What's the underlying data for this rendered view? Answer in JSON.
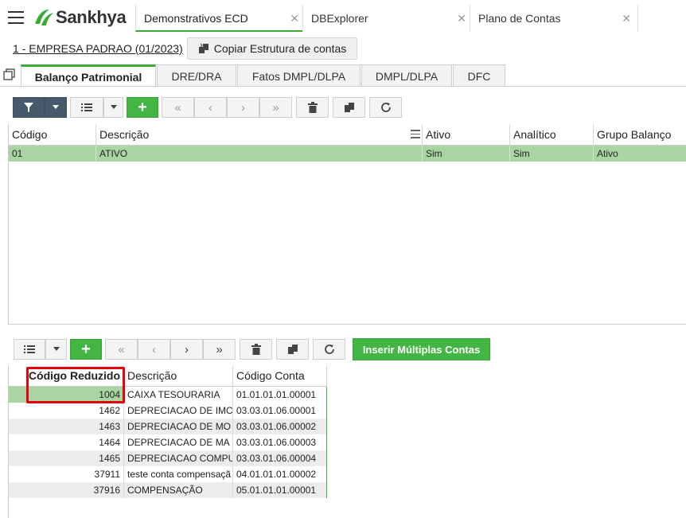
{
  "app": {
    "brand": "Sankhya"
  },
  "top_tabs": [
    {
      "label": "Demonstrativos ECD",
      "active": true
    },
    {
      "label": "DBExplorer",
      "active": false
    },
    {
      "label": "Plano de Contas",
      "active": false
    }
  ],
  "company": {
    "label": "1 - EMPRESA PADRAO (01/2023)",
    "copy_button": "Copiar Estrutura de contas"
  },
  "sub_tabs": [
    "Balanço Patrimonial",
    "DRE/DRA",
    "Fatos DMPL/DLPA",
    "DMPL/DLPA",
    "DFC"
  ],
  "toolbar1": {
    "filter_icon": "filter-icon",
    "list_icon": "list-icon",
    "add_label": "+",
    "nav": [
      "first-icon",
      "prev-icon",
      "next-icon",
      "last-icon"
    ],
    "actions": [
      "trash-icon",
      "copy-icon",
      "refresh-icon"
    ]
  },
  "grid1": {
    "columns": [
      "Código",
      "Descrição",
      "Ativo",
      "Analítico",
      "Grupo Balanço"
    ],
    "rows": [
      {
        "codigo": "01",
        "descricao": "ATIVO",
        "ativo": "Sim",
        "analitico": "Sim",
        "grupo": "Ativo"
      }
    ]
  },
  "toolbar2": {
    "add_label": "+",
    "insert_multiple": "Inserir Múltiplas Contas"
  },
  "grid2": {
    "columns": [
      "Código Reduzido",
      "Descrição",
      "Código Conta"
    ],
    "rows": [
      {
        "codigo": "1004",
        "descricao": "CAIXA TESOURARIA",
        "conta": "01.01.01.01.00001"
      },
      {
        "codigo": "1462",
        "descricao": "DEPRECIACAO DE IMC",
        "conta": "03.03.01.06.00001"
      },
      {
        "codigo": "1463",
        "descricao": "DEPRECIACAO DE MO",
        "conta": "03.03.01.06.00002"
      },
      {
        "codigo": "1464",
        "descricao": "DEPRECIACAO DE MA",
        "conta": "03.03.01.06.00003"
      },
      {
        "codigo": "1465",
        "descricao": "DEPRECIACAO COMPU",
        "conta": "03.03.01.06.00004"
      },
      {
        "codigo": "37911",
        "descricao": "teste conta compensaçã",
        "conta": "04.01.01.01.00002"
      },
      {
        "codigo": "37916",
        "descricao": "COMPENSAÇÃO",
        "conta": "05.01.01.01.00001"
      }
    ]
  },
  "colors": {
    "accent": "#3aaa35",
    "selected_row": "#a9d5a2",
    "highlight_box": "#e8000b",
    "dark_button": "#475a6b"
  }
}
